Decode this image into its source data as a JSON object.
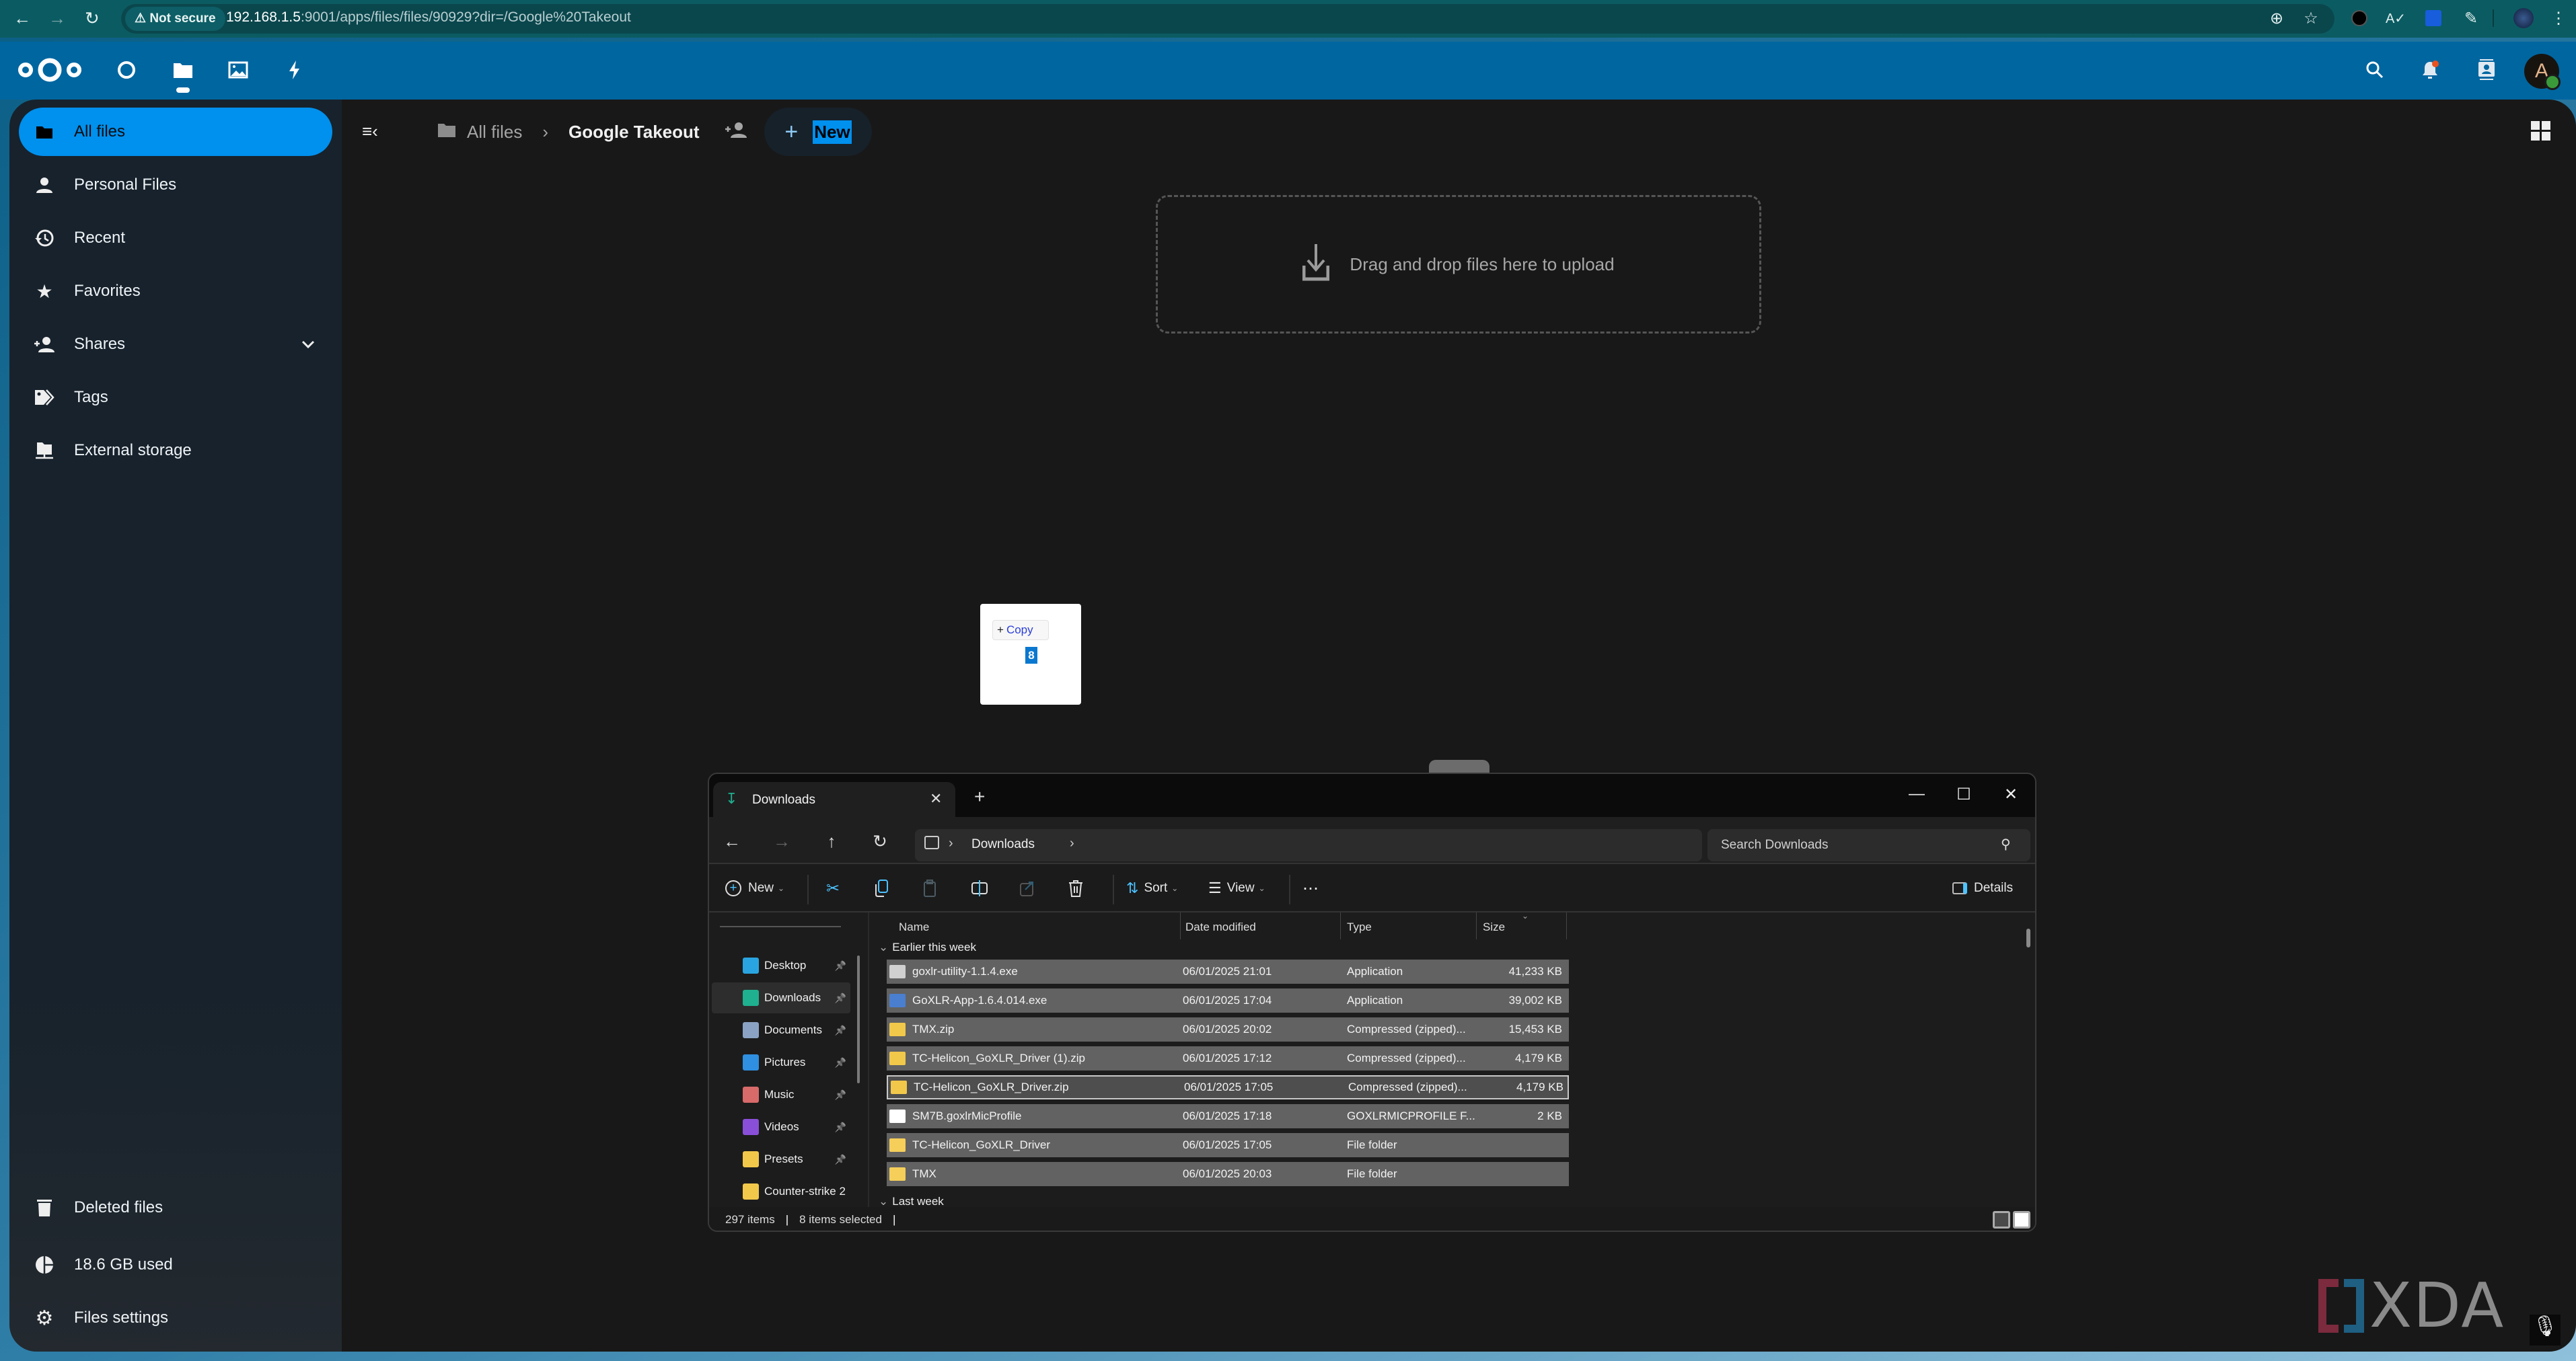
{
  "browser": {
    "security_label": "Not secure",
    "url_host": "192.168.1.5",
    "url_rest": ":9001/apps/files/files/90929?dir=/Google%20Takeout",
    "icons": [
      "back-icon",
      "forward-icon",
      "reload-icon",
      "zoom-icon",
      "bookmark-star-icon",
      "extension-wolf-icon",
      "extension-spellcheck-icon",
      "extension-bitwarden-icon",
      "extensions-puzzle-icon",
      "profile-avatar",
      "menu-kebab-icon"
    ]
  },
  "nextcloud": {
    "header_apps": [
      "dashboard",
      "files",
      "photos",
      "activity"
    ],
    "header_right": [
      "search",
      "notifications",
      "contacts",
      "user-menu"
    ],
    "avatar_letter": "A",
    "accent": "#0090ee",
    "header_color": "#0066a0",
    "sidebar": {
      "items": [
        {
          "label": "All files",
          "icon": "folder-icon",
          "active": true
        },
        {
          "label": "Personal Files",
          "icon": "person-icon"
        },
        {
          "label": "Recent",
          "icon": "history-icon"
        },
        {
          "label": "Favorites",
          "icon": "star-icon"
        },
        {
          "label": "Shares",
          "icon": "share-add-icon",
          "expandable": true
        },
        {
          "label": "Tags",
          "icon": "tag-icon"
        },
        {
          "label": "External storage",
          "icon": "network-folder-icon"
        }
      ],
      "footer": [
        {
          "label": "Deleted files",
          "icon": "trash-icon"
        },
        {
          "label": "18.6 GB used",
          "icon": "pie-icon"
        },
        {
          "label": "Files settings",
          "icon": "gear-icon"
        }
      ]
    },
    "breadcrumb": {
      "root": "All files",
      "current": "Google Takeout",
      "new_button": "New"
    },
    "dropzone_text": "Drag and drop files here to upload",
    "drag_overlay": {
      "action": "Copy",
      "count": "8"
    }
  },
  "explorer": {
    "tab_title": "Downloads",
    "address_segment": "Downloads",
    "search_placeholder": "Search Downloads",
    "commands": {
      "new": "New",
      "sort": "Sort",
      "view": "View",
      "details": "Details"
    },
    "nav_items": [
      {
        "label": "Desktop",
        "color": "#2aa4e0",
        "pinned": true
      },
      {
        "label": "Downloads",
        "color": "#1fb08f",
        "pinned": true,
        "selected": true
      },
      {
        "label": "Documents",
        "color": "#8aa3c4",
        "pinned": true
      },
      {
        "label": "Pictures",
        "color": "#2f8fe0",
        "pinned": true
      },
      {
        "label": "Music",
        "color": "#d86a6a",
        "pinned": true
      },
      {
        "label": "Videos",
        "color": "#8a4fd8",
        "pinned": true
      },
      {
        "label": "Presets",
        "color": "#f2c84b",
        "pinned": true
      },
      {
        "label": "Counter-strike 2",
        "color": "#f2c84b",
        "pinned": false
      }
    ],
    "columns": [
      "Name",
      "Date modified",
      "Type",
      "Size"
    ],
    "groups": [
      "Earlier this week",
      "Last week"
    ],
    "files": [
      {
        "name": "goxlr-utility-1.1.4.exe",
        "date": "06/01/2025 21:01",
        "type": "Application",
        "size": "41,233 KB",
        "icon": "exe"
      },
      {
        "name": "GoXLR-App-1.6.4.014.exe",
        "date": "06/01/2025 17:04",
        "type": "Application",
        "size": "39,002 KB",
        "icon": "installer"
      },
      {
        "name": "TMX.zip",
        "date": "06/01/2025 20:02",
        "type": "Compressed (zipped)...",
        "size": "15,453 KB",
        "icon": "zip"
      },
      {
        "name": "TC-Helicon_GoXLR_Driver (1).zip",
        "date": "06/01/2025 17:12",
        "type": "Compressed (zipped)...",
        "size": "4,179 KB",
        "icon": "zip"
      },
      {
        "name": "TC-Helicon_GoXLR_Driver.zip",
        "date": "06/01/2025 17:05",
        "type": "Compressed (zipped)...",
        "size": "4,179 KB",
        "icon": "zip",
        "focused": true
      },
      {
        "name": "SM7B.goxlrMicProfile",
        "date": "06/01/2025 17:18",
        "type": "GOXLRMICPROFILE F...",
        "size": "2 KB",
        "icon": "file"
      },
      {
        "name": "TC-Helicon_GoXLR_Driver",
        "date": "06/01/2025 17:05",
        "type": "File folder",
        "size": "",
        "icon": "folder"
      },
      {
        "name": "TMX",
        "date": "06/01/2025 20:03",
        "type": "File folder",
        "size": "",
        "icon": "folder"
      }
    ],
    "status": {
      "items": "297 items",
      "selected": "8 items selected"
    }
  },
  "watermark": "XDA"
}
